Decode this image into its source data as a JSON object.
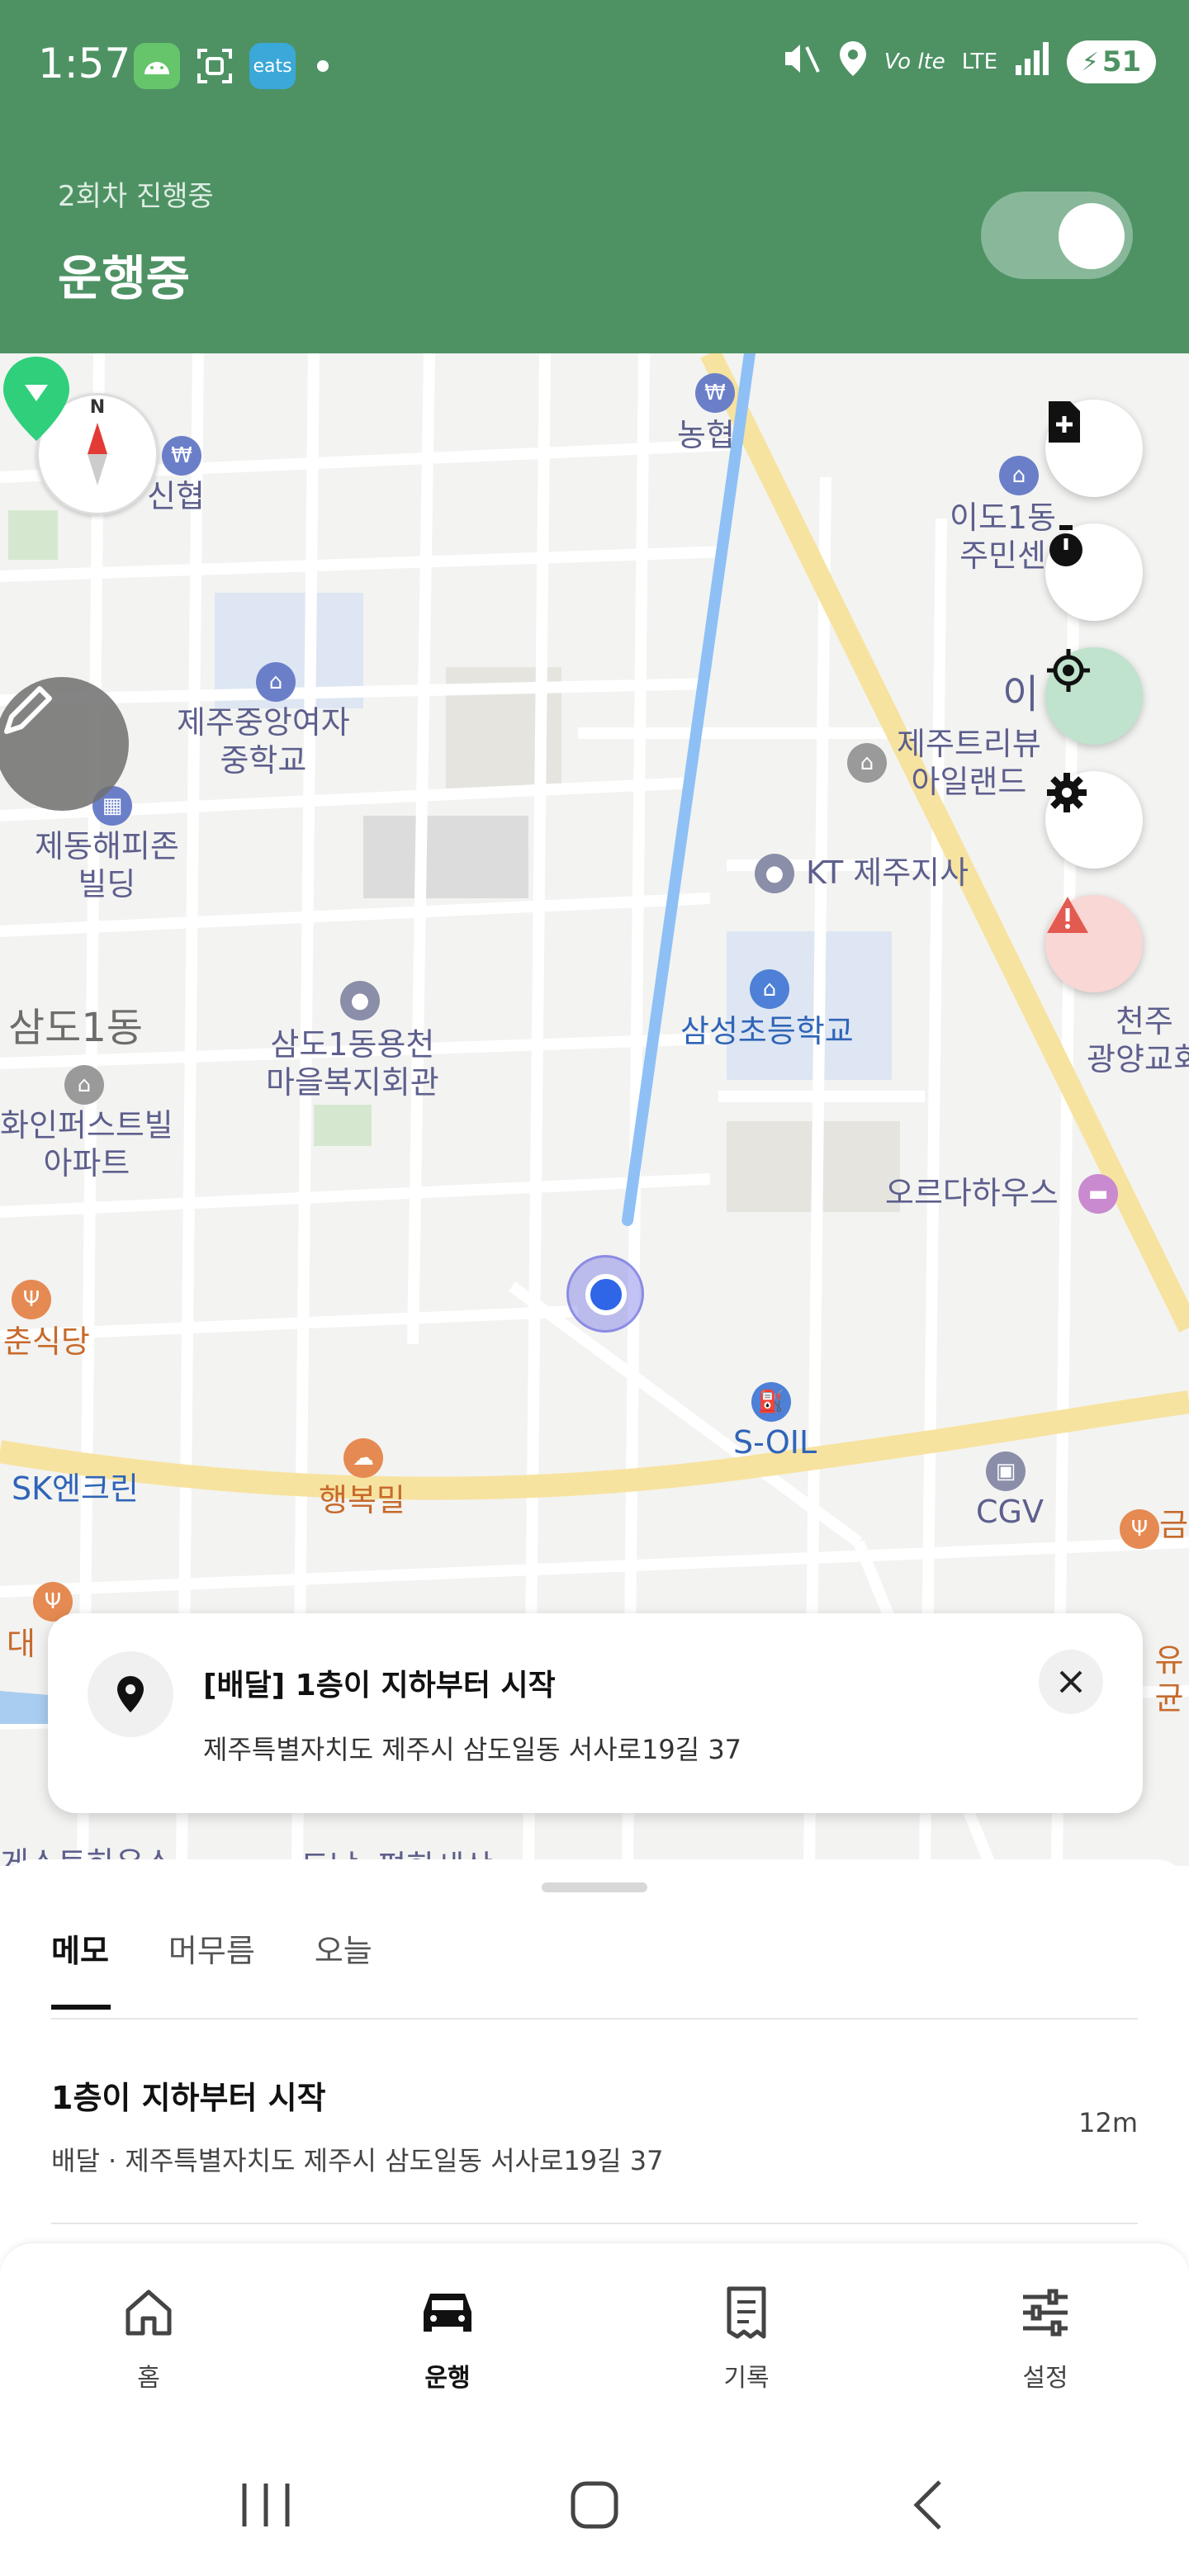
{
  "status_bar": {
    "time": "1:57",
    "battery": "51",
    "network": "LTE",
    "app_icons": [
      "android-icon",
      "screenshot-icon",
      "eats-icon"
    ],
    "eats_label": "eats"
  },
  "header": {
    "subtitle": "2회차 진행중",
    "title": "운행중",
    "toggle_on": true
  },
  "map": {
    "pois": [
      {
        "name": "농협",
        "color": "purple"
      },
      {
        "name": "신협",
        "color": "purple"
      },
      {
        "name": "이도1동\n주민센",
        "color": "purple"
      },
      {
        "name": "제주중앙여자\n중학교",
        "color": "purple"
      },
      {
        "name": "제주트리뷰\n아일랜드",
        "color": "purple"
      },
      {
        "name": "제동해피존\n빌딩",
        "color": "purple"
      },
      {
        "name": "KT 제주지사",
        "color": "purple"
      },
      {
        "name": "삼도1동",
        "color": "gray"
      },
      {
        "name": "삼도1동용천\n마을복지회관",
        "color": "purple"
      },
      {
        "name": "삼성초등학교",
        "color": "blue"
      },
      {
        "name": "천주\n광양교회",
        "color": "purple"
      },
      {
        "name": "화인퍼스트빌\n아파트",
        "color": "purple"
      },
      {
        "name": "오르다하우스",
        "color": "purple"
      },
      {
        "name": "춘식당",
        "color": "orange"
      },
      {
        "name": "S-OIL",
        "color": "blue"
      },
      {
        "name": "SK엔크린",
        "color": "blue"
      },
      {
        "name": "행복밀",
        "color": "orange"
      },
      {
        "name": "CGV",
        "color": "purple"
      },
      {
        "name": "대",
        "color": "orange"
      },
      {
        "name": "유균",
        "color": "orange"
      },
      {
        "name": "이",
        "color": "purple"
      },
      {
        "name": "금",
        "color": "orange"
      },
      {
        "name": "게스트하우스",
        "color": "purple"
      },
      {
        "name": "도남e편한세상",
        "color": "purple"
      }
    ],
    "compass_label": "N"
  },
  "info_card": {
    "title": "[배달] 1층이 지하부터 시작",
    "address": "제주특별자치도 제주시 삼도일동 서사로19길 37"
  },
  "sheet": {
    "tabs": [
      {
        "label": "메모",
        "active": true
      },
      {
        "label": "머무름",
        "active": false
      },
      {
        "label": "오늘",
        "active": false
      }
    ],
    "memo": {
      "title": "1층이 지하부터 시작",
      "subtitle": "배달 · 제주특별자치도 제주시 삼도일동 서사로19길 37",
      "time": "12m"
    }
  },
  "bottom_nav": [
    {
      "label": "홈",
      "icon": "home-icon",
      "active": false
    },
    {
      "label": "운행",
      "icon": "car-icon",
      "active": true
    },
    {
      "label": "기록",
      "icon": "receipt-icon",
      "active": false
    },
    {
      "label": "설정",
      "icon": "sliders-icon",
      "active": false
    }
  ],
  "colors": {
    "header": "#4e9264",
    "route": "#8ec0f5",
    "marker": "#2fcf7c",
    "accent_red": "#e35a50"
  }
}
